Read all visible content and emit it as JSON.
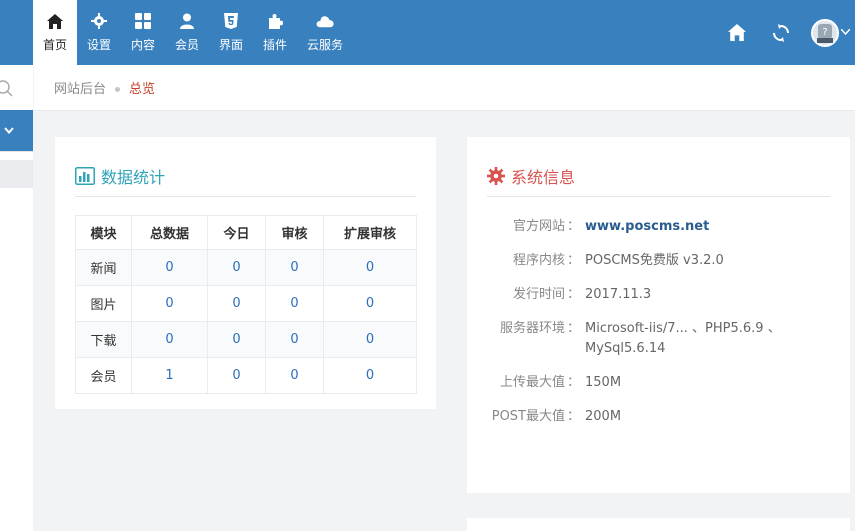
{
  "nav": {
    "items": [
      {
        "label": "首页",
        "icon": "home-icon"
      },
      {
        "label": "设置",
        "icon": "gear-icon"
      },
      {
        "label": "内容",
        "icon": "grid-icon"
      },
      {
        "label": "会员",
        "icon": "user-icon"
      },
      {
        "label": "界面",
        "icon": "html5-icon"
      },
      {
        "label": "插件",
        "icon": "puzzle-icon"
      },
      {
        "label": "云服务",
        "icon": "cloud-icon"
      }
    ]
  },
  "breadcrumb": {
    "home": "网站后台",
    "current": "总览"
  },
  "stats": {
    "title": "数据统计",
    "headers": [
      "模块",
      "总数据",
      "今日",
      "审核",
      "扩展审核"
    ],
    "rows": [
      [
        "新闻",
        "0",
        "0",
        "0",
        "0"
      ],
      [
        "图片",
        "0",
        "0",
        "0",
        "0"
      ],
      [
        "下载",
        "0",
        "0",
        "0",
        "0"
      ],
      [
        "会员",
        "1",
        "0",
        "0",
        "0"
      ]
    ]
  },
  "system": {
    "title": "系统信息",
    "separator": "：",
    "rows": [
      {
        "label": "官方网站",
        "value": "www.poscms.net"
      },
      {
        "label": "程序内核",
        "value": "POSCMS免费版 v3.2.0"
      },
      {
        "label": "发行时间",
        "value": "2017.11.3"
      },
      {
        "label": "服务器环境",
        "value": "Microsoft-iis/7... 、PHP5.6.9 、MySql5.6.14"
      },
      {
        "label": "上传最大值",
        "value": "150M"
      },
      {
        "label": "POST最大值",
        "value": "200M"
      }
    ]
  },
  "colors": {
    "topbar": "#3980bf",
    "accent_red": "#c5432b",
    "title_blue": "#2fa4b8"
  }
}
